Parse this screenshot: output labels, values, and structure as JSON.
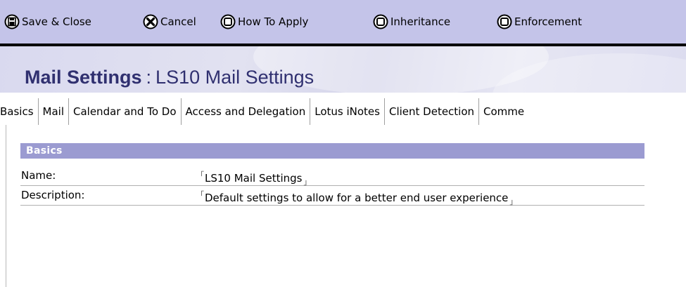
{
  "toolbar": {
    "buttons": [
      {
        "label": "Save & Close",
        "icon": "save-disk-icon"
      },
      {
        "label": "Cancel",
        "icon": "cancel-x-icon"
      },
      {
        "label": "How To Apply",
        "icon": "square-button-icon"
      },
      {
        "label": "Inheritance",
        "icon": "square-button-icon"
      },
      {
        "label": "Enforcement",
        "icon": "square-button-icon"
      }
    ]
  },
  "header": {
    "title_main": "Mail Settings",
    "title_sep": ":",
    "title_sub": "LS10 Mail Settings"
  },
  "tabs": [
    {
      "label": "Basics",
      "active": true
    },
    {
      "label": "Mail",
      "active": false
    },
    {
      "label": "Calendar and To Do",
      "active": false
    },
    {
      "label": "Access and Delegation",
      "active": false
    },
    {
      "label": "Lotus iNotes",
      "active": false
    },
    {
      "label": "Client Detection",
      "active": false
    },
    {
      "label": "Comme",
      "active": false
    }
  ],
  "section": {
    "title": "Basics",
    "fields": [
      {
        "label": "Name:",
        "value": "LS10 Mail Settings"
      },
      {
        "label": "Description:",
        "value": "Default settings to allow for a better end user experience"
      }
    ]
  },
  "glyphs": {
    "field_open": "「",
    "field_close": "」"
  },
  "colors": {
    "toolbar_bg": "#c4c4e9",
    "title_text": "#303070",
    "section_bar": "#9b9bd1"
  }
}
